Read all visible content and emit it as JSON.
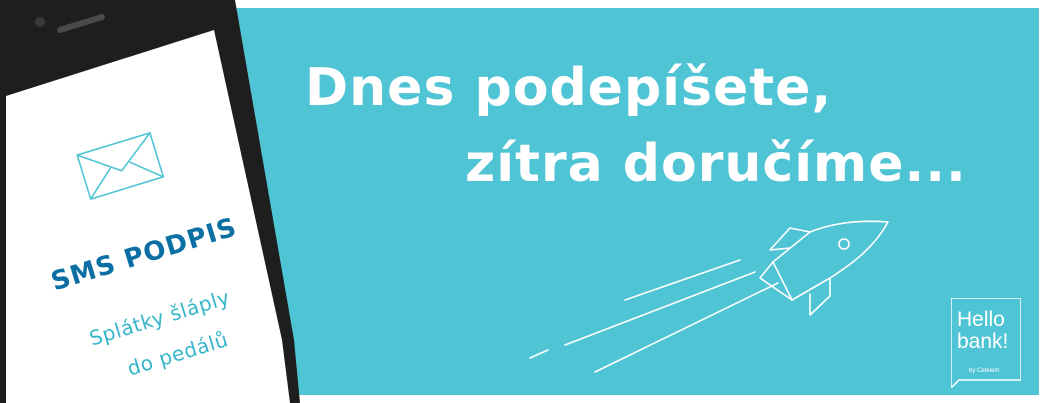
{
  "headline": {
    "line1": "Dnes podepíšete,",
    "line2": "zítra doručíme..."
  },
  "phone_screen": {
    "icon": "envelope-icon",
    "title": "SMS PODPIS",
    "subtitle_line1": "Splátky šláply",
    "subtitle_line2": "do pedálů"
  },
  "decoration": {
    "icon": "rocket-icon"
  },
  "logo": {
    "line1": "Hello",
    "line2": "bank!",
    "tagline": "by Cetelem"
  },
  "colors": {
    "background": "#4fc4d4",
    "headline": "#ffffff",
    "phone_title": "#0b6fa4",
    "phone_subtitle": "#37b6cb",
    "phone_body": "#1e1e1e",
    "logo_badge": "#4fc4d4"
  }
}
